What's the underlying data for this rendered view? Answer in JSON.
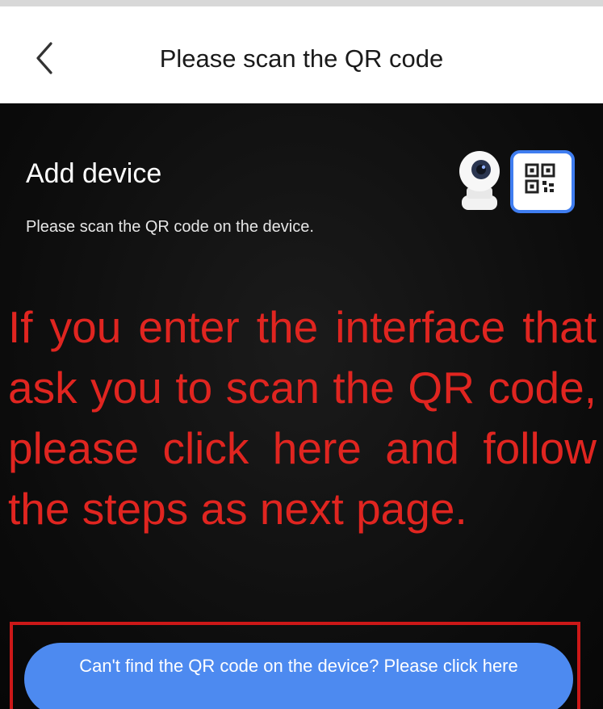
{
  "header": {
    "title": "Please scan the QR code"
  },
  "section": {
    "title": "Add device",
    "subtitle": "Please scan the QR code on the device."
  },
  "overlay": {
    "instruction": "If you enter the interface that ask you to scan the QR code, please click here and follow the steps as next page."
  },
  "help_button": {
    "label": "Can't find the QR code on the device? Please click here"
  },
  "colors": {
    "nav_background": "#ffffff",
    "content_background": "#0d0d0d",
    "instruction_red": "#e02520",
    "frame_red": "#cc1818",
    "button_blue": "#4d8af0",
    "qr_card_border": "#3f7df0"
  },
  "icons": {
    "back": "chevron-left-icon",
    "illustration": "camera-device-icon",
    "qr": "qr-code-icon"
  }
}
